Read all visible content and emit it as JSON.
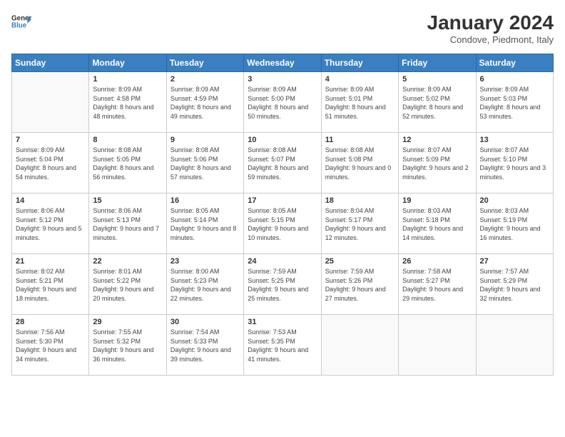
{
  "logo": {
    "text_general": "General",
    "text_blue": "Blue"
  },
  "header": {
    "title": "January 2024",
    "location": "Condove, Piedmont, Italy"
  },
  "days_of_week": [
    "Sunday",
    "Monday",
    "Tuesday",
    "Wednesday",
    "Thursday",
    "Friday",
    "Saturday"
  ],
  "weeks": [
    [
      {
        "day": null,
        "info": null
      },
      {
        "day": "1",
        "sunrise": "8:09 AM",
        "sunset": "4:58 PM",
        "daylight": "8 hours and 48 minutes."
      },
      {
        "day": "2",
        "sunrise": "8:09 AM",
        "sunset": "4:59 PM",
        "daylight": "8 hours and 49 minutes."
      },
      {
        "day": "3",
        "sunrise": "8:09 AM",
        "sunset": "5:00 PM",
        "daylight": "8 hours and 50 minutes."
      },
      {
        "day": "4",
        "sunrise": "8:09 AM",
        "sunset": "5:01 PM",
        "daylight": "8 hours and 51 minutes."
      },
      {
        "day": "5",
        "sunrise": "8:09 AM",
        "sunset": "5:02 PM",
        "daylight": "8 hours and 52 minutes."
      },
      {
        "day": "6",
        "sunrise": "8:09 AM",
        "sunset": "5:03 PM",
        "daylight": "8 hours and 53 minutes."
      }
    ],
    [
      {
        "day": "7",
        "sunrise": "8:09 AM",
        "sunset": "5:04 PM",
        "daylight": "8 hours and 54 minutes."
      },
      {
        "day": "8",
        "sunrise": "8:08 AM",
        "sunset": "5:05 PM",
        "daylight": "8 hours and 56 minutes."
      },
      {
        "day": "9",
        "sunrise": "8:08 AM",
        "sunset": "5:06 PM",
        "daylight": "8 hours and 57 minutes."
      },
      {
        "day": "10",
        "sunrise": "8:08 AM",
        "sunset": "5:07 PM",
        "daylight": "8 hours and 59 minutes."
      },
      {
        "day": "11",
        "sunrise": "8:08 AM",
        "sunset": "5:08 PM",
        "daylight": "9 hours and 0 minutes."
      },
      {
        "day": "12",
        "sunrise": "8:07 AM",
        "sunset": "5:09 PM",
        "daylight": "9 hours and 2 minutes."
      },
      {
        "day": "13",
        "sunrise": "8:07 AM",
        "sunset": "5:10 PM",
        "daylight": "9 hours and 3 minutes."
      }
    ],
    [
      {
        "day": "14",
        "sunrise": "8:06 AM",
        "sunset": "5:12 PM",
        "daylight": "9 hours and 5 minutes."
      },
      {
        "day": "15",
        "sunrise": "8:06 AM",
        "sunset": "5:13 PM",
        "daylight": "9 hours and 7 minutes."
      },
      {
        "day": "16",
        "sunrise": "8:05 AM",
        "sunset": "5:14 PM",
        "daylight": "9 hours and 8 minutes."
      },
      {
        "day": "17",
        "sunrise": "8:05 AM",
        "sunset": "5:15 PM",
        "daylight": "9 hours and 10 minutes."
      },
      {
        "day": "18",
        "sunrise": "8:04 AM",
        "sunset": "5:17 PM",
        "daylight": "9 hours and 12 minutes."
      },
      {
        "day": "19",
        "sunrise": "8:03 AM",
        "sunset": "5:18 PM",
        "daylight": "9 hours and 14 minutes."
      },
      {
        "day": "20",
        "sunrise": "8:03 AM",
        "sunset": "5:19 PM",
        "daylight": "9 hours and 16 minutes."
      }
    ],
    [
      {
        "day": "21",
        "sunrise": "8:02 AM",
        "sunset": "5:21 PM",
        "daylight": "9 hours and 18 minutes."
      },
      {
        "day": "22",
        "sunrise": "8:01 AM",
        "sunset": "5:22 PM",
        "daylight": "9 hours and 20 minutes."
      },
      {
        "day": "23",
        "sunrise": "8:00 AM",
        "sunset": "5:23 PM",
        "daylight": "9 hours and 22 minutes."
      },
      {
        "day": "24",
        "sunrise": "7:59 AM",
        "sunset": "5:25 PM",
        "daylight": "9 hours and 25 minutes."
      },
      {
        "day": "25",
        "sunrise": "7:59 AM",
        "sunset": "5:26 PM",
        "daylight": "9 hours and 27 minutes."
      },
      {
        "day": "26",
        "sunrise": "7:58 AM",
        "sunset": "5:27 PM",
        "daylight": "9 hours and 29 minutes."
      },
      {
        "day": "27",
        "sunrise": "7:57 AM",
        "sunset": "5:29 PM",
        "daylight": "9 hours and 32 minutes."
      }
    ],
    [
      {
        "day": "28",
        "sunrise": "7:56 AM",
        "sunset": "5:30 PM",
        "daylight": "9 hours and 34 minutes."
      },
      {
        "day": "29",
        "sunrise": "7:55 AM",
        "sunset": "5:32 PM",
        "daylight": "9 hours and 36 minutes."
      },
      {
        "day": "30",
        "sunrise": "7:54 AM",
        "sunset": "5:33 PM",
        "daylight": "9 hours and 39 minutes."
      },
      {
        "day": "31",
        "sunrise": "7:53 AM",
        "sunset": "5:35 PM",
        "daylight": "9 hours and 41 minutes."
      },
      {
        "day": null,
        "info": null
      },
      {
        "day": null,
        "info": null
      },
      {
        "day": null,
        "info": null
      }
    ]
  ]
}
